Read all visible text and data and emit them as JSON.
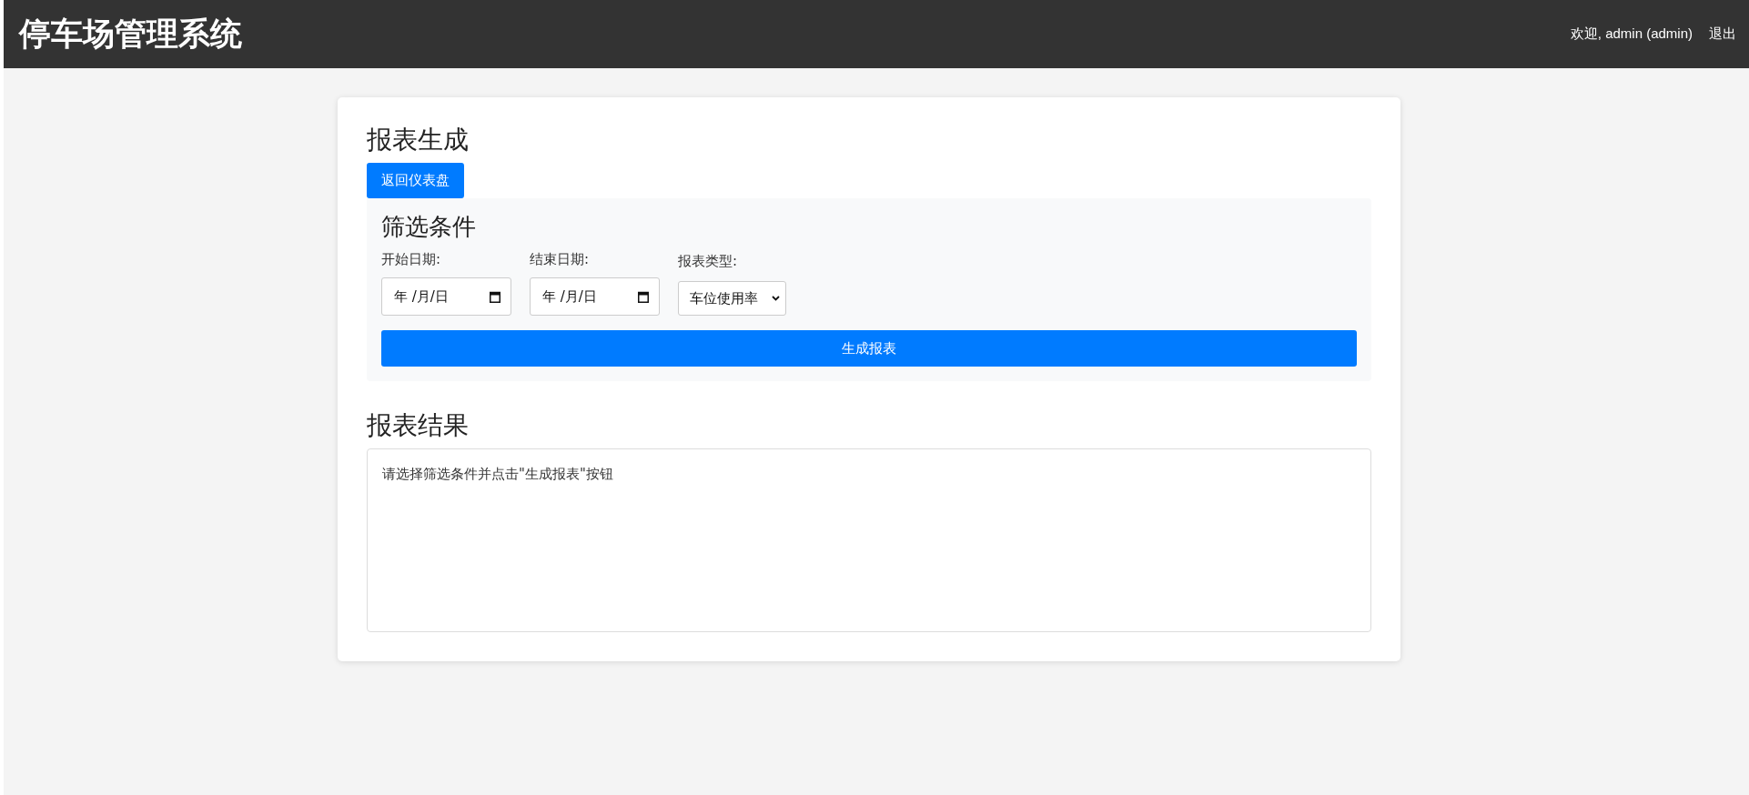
{
  "header": {
    "title": "停车场管理系统",
    "welcome": "欢迎, admin (admin)",
    "logout": "退出"
  },
  "page": {
    "title": "报表生成",
    "back_button": "返回仪表盘"
  },
  "filters": {
    "title": "筛选条件",
    "fields": [
      {
        "kind": "date",
        "label": "开始日期:",
        "value": "年 /月/日"
      },
      {
        "kind": "date",
        "label": "结束日期:",
        "value": "年 /月/日"
      },
      {
        "kind": "select",
        "label": "报表类型:",
        "value": "车位使用率"
      }
    ],
    "submit": "生成报表"
  },
  "results": {
    "title": "报表结果",
    "message": "请选择筛选条件并点击\"生成报表\"按钮"
  }
}
